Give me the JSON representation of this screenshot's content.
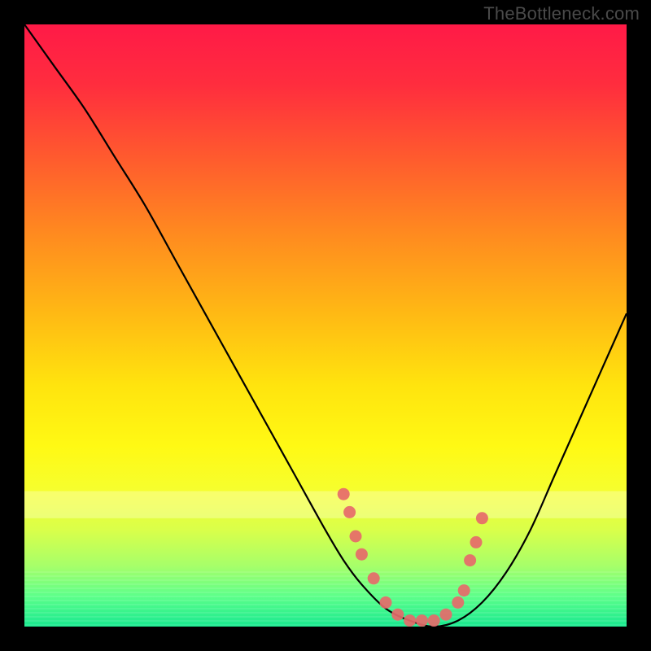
{
  "watermark": "TheBottleneck.com",
  "chart_data": {
    "type": "line",
    "title": "",
    "xlabel": "",
    "ylabel": "",
    "xlim": [
      0,
      100
    ],
    "ylim": [
      0,
      100
    ],
    "curve": {
      "x": [
        0,
        5,
        10,
        15,
        20,
        25,
        30,
        35,
        40,
        45,
        50,
        53,
        56,
        60,
        64,
        68,
        72,
        76,
        80,
        84,
        88,
        92,
        96,
        100
      ],
      "y": [
        100,
        93,
        86,
        78,
        70,
        61,
        52,
        43,
        34,
        25,
        16,
        11,
        7,
        3,
        1,
        0,
        1,
        4,
        9,
        16,
        25,
        34,
        43,
        52
      ]
    },
    "scatter": {
      "x": [
        53,
        54,
        55,
        56,
        58,
        60,
        62,
        64,
        66,
        68,
        70,
        72,
        73,
        74,
        75,
        76
      ],
      "y": [
        22,
        19,
        15,
        12,
        8,
        4,
        2,
        1,
        1,
        1,
        2,
        4,
        6,
        11,
        14,
        18
      ]
    },
    "gradient_stops": [
      {
        "offset": 0.0,
        "color": "#ff1a47"
      },
      {
        "offset": 0.1,
        "color": "#ff2d3e"
      },
      {
        "offset": 0.22,
        "color": "#ff5a2e"
      },
      {
        "offset": 0.35,
        "color": "#ff8b1f"
      },
      {
        "offset": 0.48,
        "color": "#ffb914"
      },
      {
        "offset": 0.6,
        "color": "#ffe40e"
      },
      {
        "offset": 0.7,
        "color": "#fff914"
      },
      {
        "offset": 0.78,
        "color": "#f5ff30"
      },
      {
        "offset": 0.84,
        "color": "#d9ff4a"
      },
      {
        "offset": 0.9,
        "color": "#a6ff6a"
      },
      {
        "offset": 0.95,
        "color": "#5cff8a"
      },
      {
        "offset": 1.0,
        "color": "#18e98f"
      }
    ],
    "scatter_color": "#e66a6a",
    "curve_color": "#000000"
  }
}
